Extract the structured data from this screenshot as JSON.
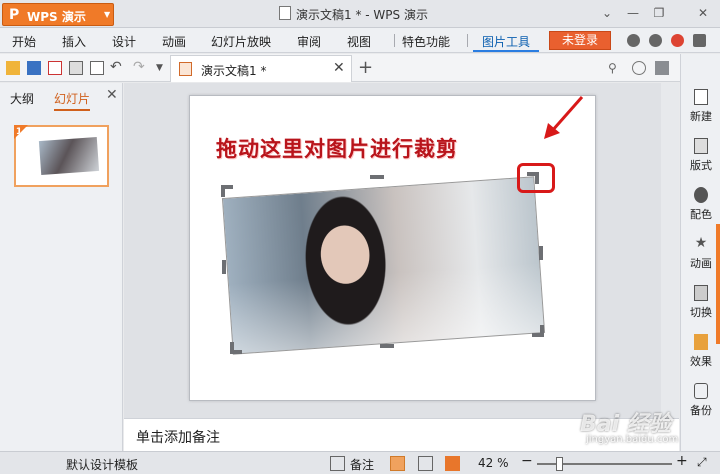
{
  "titlebar": {
    "app_logo": "P",
    "app_name": "WPS 演示",
    "window_title": "演示文稿1 * - WPS 演示"
  },
  "menubar": {
    "items": [
      "开始",
      "插入",
      "设计",
      "动画",
      "幻灯片放映",
      "审阅",
      "视图",
      "特色功能",
      "图片工具"
    ],
    "active": "图片工具",
    "login_label": "未登录"
  },
  "toolbar": {
    "doc_tab_label": "演示文稿1 *",
    "add_tab": "+"
  },
  "left_panel": {
    "tabs": [
      "大纲",
      "幻灯片"
    ],
    "active_tab": "幻灯片",
    "slide_number": "1"
  },
  "slide": {
    "annotation_text": "拖动这里对图片进行裁剪"
  },
  "notes": {
    "placeholder": "单击添加备注"
  },
  "right_panel": {
    "items": [
      "新建",
      "版式",
      "配色",
      "动画",
      "切换",
      "效果",
      "备份"
    ]
  },
  "statusbar": {
    "template_name": "默认设计模板",
    "notes_label": "备注",
    "zoom": "42 %",
    "zoom_minus": "−",
    "zoom_plus": "+"
  },
  "watermark": {
    "main": "Bai 经验",
    "sub": "jingyan.baidu.com"
  },
  "colors": {
    "accent_orange": "#f07a28",
    "annotation_red": "#b8141b",
    "highlight_red": "#d81919",
    "active_tab_blue": "#2a7de1"
  }
}
